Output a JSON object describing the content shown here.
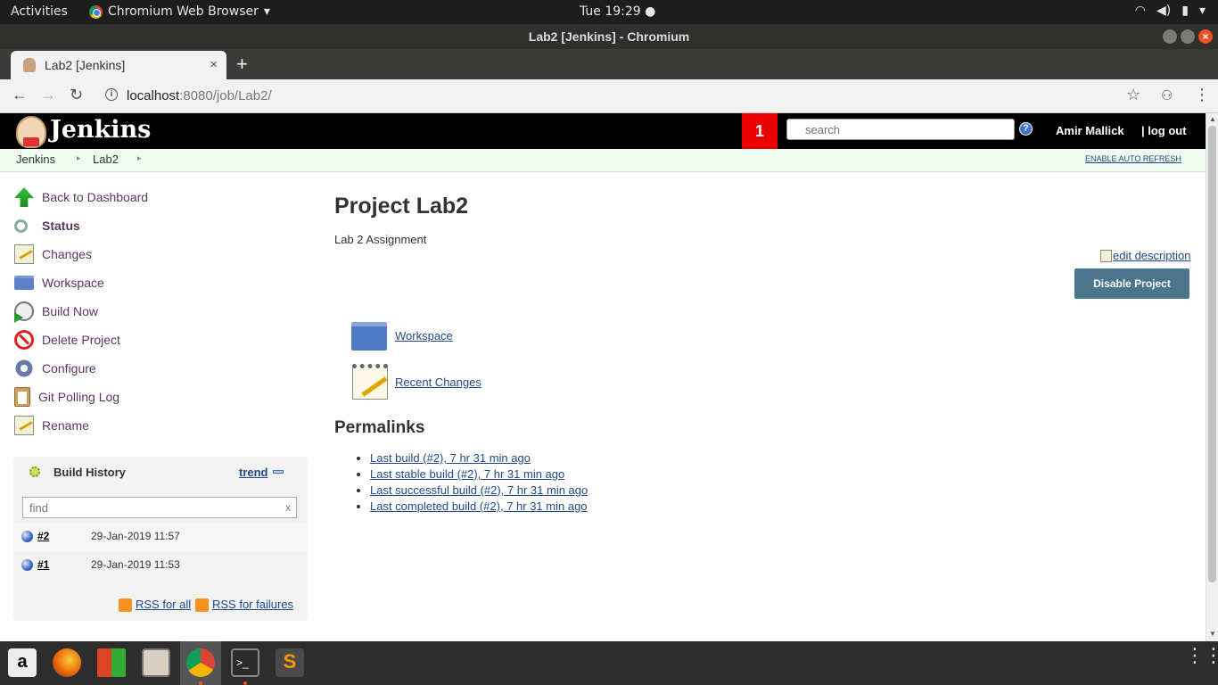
{
  "os": {
    "activities": "Activities",
    "app_menu": "Chromium Web Browser",
    "clock": "Tue 19:29 ●",
    "tray": [
      "wifi-icon",
      "volume-icon",
      "battery-icon",
      "power-menu-icon"
    ]
  },
  "window": {
    "title": "Lab2 [Jenkins] - Chromium"
  },
  "browser": {
    "tab_title": "Lab2 [Jenkins]",
    "tab_close": "×",
    "new_tab": "+",
    "url_host": "localhost",
    "url_rest": ":8080/job/Lab2/",
    "star": "☆"
  },
  "jenkins": {
    "logo_text": "Jenkins",
    "notification_count": "1",
    "search_placeholder": "search",
    "help": "?",
    "user": "Amir Mallick",
    "logout": "| log out",
    "breadcrumbs": [
      "Jenkins",
      "Lab2"
    ],
    "enable_auto_refresh": "ENABLE AUTO REFRESH"
  },
  "sidebar": {
    "tasks": [
      {
        "label": "Back to Dashboard",
        "icon": "up-arrow-icon"
      },
      {
        "label": "Status",
        "icon": "magnifier-icon"
      },
      {
        "label": "Changes",
        "icon": "notepad-icon"
      },
      {
        "label": "Workspace",
        "icon": "folder-icon"
      },
      {
        "label": "Build Now",
        "icon": "clock-play-icon"
      },
      {
        "label": "Delete Project",
        "icon": "no-entry-icon"
      },
      {
        "label": "Configure",
        "icon": "gear-icon"
      },
      {
        "label": "Git Polling Log",
        "icon": "clipboard-icon"
      },
      {
        "label": "Rename",
        "icon": "notepad-icon"
      }
    ]
  },
  "build_history": {
    "title": "Build History",
    "trend": "trend",
    "find_placeholder": "find",
    "find_clear": "x",
    "builds": [
      {
        "number": "#2",
        "date": "29-Jan-2019 11:57"
      },
      {
        "number": "#1",
        "date": "29-Jan-2019 11:53"
      }
    ],
    "rss_all": "RSS for all",
    "rss_failures": "RSS for failures"
  },
  "main": {
    "title": "Project Lab2",
    "description": "Lab 2 Assignment",
    "edit_description": "edit description",
    "disable_button": "Disable Project",
    "workspace_link": "Workspace",
    "recent_changes_link": "Recent Changes",
    "permalinks_heading": "Permalinks",
    "permalinks": [
      "Last build (#2), 7 hr 31 min ago",
      "Last stable build (#2), 7 hr 31 min ago",
      "Last successful build (#2), 7 hr 31 min ago",
      "Last completed build (#2), 7 hr 31 min ago"
    ]
  },
  "dock": {
    "apps": [
      "amazon-icon",
      "firefox-icon",
      "app-grid-colored-icon",
      "files-icon",
      "chromium-icon",
      "terminal-icon",
      "sublime-text-icon"
    ],
    "show_apps": "⋮⋮⋮"
  }
}
